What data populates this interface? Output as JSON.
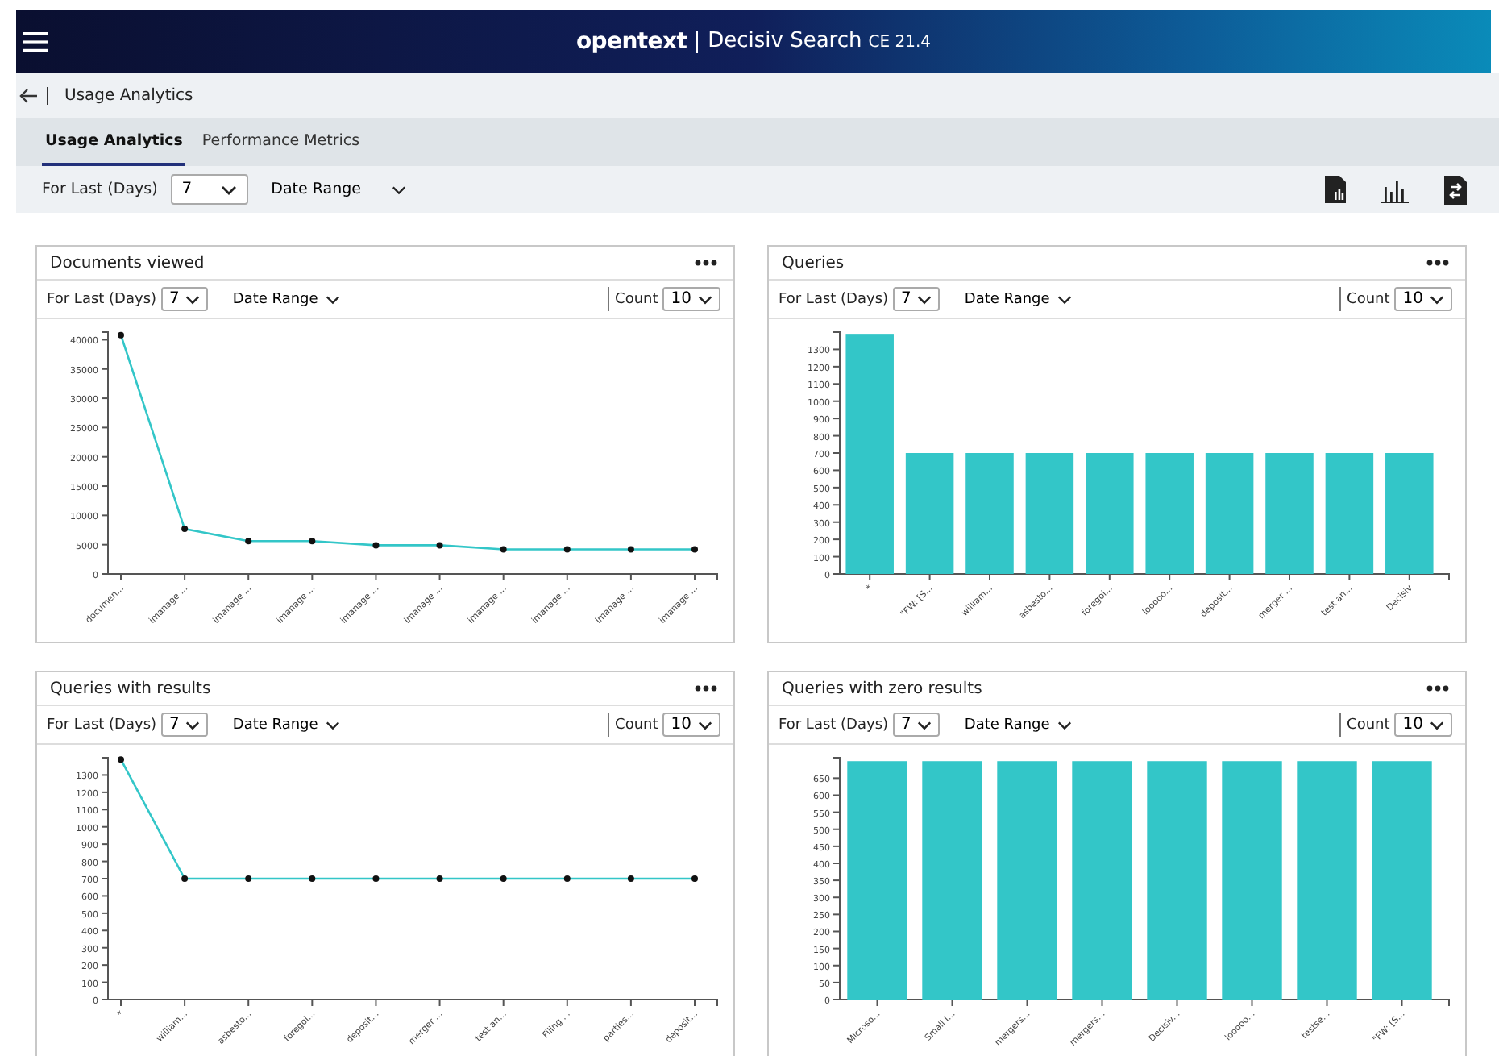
{
  "header": {
    "logo": "opentext",
    "product": "Decisiv Search",
    "version": "CE 21.4"
  },
  "breadcrumb": {
    "title": "Usage Analytics"
  },
  "tabs": [
    {
      "label": "Usage Analytics",
      "selected": true
    },
    {
      "label": "Performance Metrics",
      "selected": false
    }
  ],
  "filters": {
    "days_label": "For Last (Days)",
    "days_value": "7",
    "date_range": "Date Range"
  },
  "panels": [
    {
      "title": "Documents viewed",
      "days_label": "For Last (Days)",
      "days_value": "7",
      "date_range": "Date Range",
      "count_label": "Count",
      "count_value": "10",
      "chart_data": {
        "type": "line",
        "categories": [
          "documen...",
          "imanage ...",
          "imanage ...",
          "imanage ...",
          "imanage ...",
          "imanage ...",
          "imanage ...",
          "imanage ...",
          "imanage ...",
          "imanage ..."
        ],
        "series": [
          {
            "color": "#33c6c8",
            "marker": true,
            "values": [
              40800,
              7700,
              5600,
              5600,
              4900,
              4900,
              4200,
              4200,
              4200,
              4200
            ]
          }
        ],
        "ylim": [
          0,
          41300
        ],
        "yticks": [
          0,
          5000,
          10000,
          15000,
          20000,
          25000,
          30000,
          35000,
          40000
        ]
      }
    },
    {
      "title": "Queries",
      "days_label": "For Last (Days)",
      "days_value": "7",
      "date_range": "Date Range",
      "count_label": "Count",
      "count_value": "10",
      "chart_data": {
        "type": "bar",
        "categories": [
          "*",
          "\"FW: [S...",
          "william...",
          "asbesto...",
          "foregoi...",
          "looooo...",
          "deposit...",
          "merger ...",
          "test an...",
          "Decisiv"
        ],
        "series": [
          {
            "color": "#33c6c8",
            "values": [
              1390,
              700,
              700,
              700,
              700,
              700,
              700,
              700,
              700,
              700
            ]
          }
        ],
        "ylim": [
          0,
          1400
        ],
        "yticks": [
          0,
          100,
          200,
          300,
          400,
          500,
          600,
          700,
          800,
          900,
          1000,
          1100,
          1200,
          1300
        ]
      }
    },
    {
      "title": "Queries with results",
      "days_label": "For Last (Days)",
      "days_value": "7",
      "date_range": "Date Range",
      "count_label": "Count",
      "count_value": "10",
      "chart_data": {
        "type": "line",
        "categories": [
          "*",
          "william...",
          "asbesto...",
          "foregoi...",
          "deposit...",
          "merger ...",
          "test an...",
          "Filing ...",
          "parties...",
          "deposit..."
        ],
        "series": [
          {
            "color": "#33c6c8",
            "marker": true,
            "values": [
              1390,
              700,
              700,
              700,
              700,
              700,
              700,
              700,
              700,
              700
            ]
          }
        ],
        "ylim": [
          0,
          1400
        ],
        "yticks": [
          0,
          100,
          200,
          300,
          400,
          500,
          600,
          700,
          800,
          900,
          1000,
          1100,
          1200,
          1300
        ]
      }
    },
    {
      "title": "Queries with zero results",
      "days_label": "For Last (Days)",
      "days_value": "7",
      "date_range": "Date Range",
      "count_label": "Count",
      "count_value": "10",
      "chart_data": {
        "type": "bar",
        "categories": [
          "Microso...",
          "Small I...",
          "mergers...",
          "mergers...",
          "Decisiv...",
          "looooo...",
          "testse...",
          "\"FW: [S..."
        ],
        "series": [
          {
            "color": "#33c6c8",
            "values": [
              700,
              700,
              700,
              700,
              700,
              700,
              700,
              700
            ]
          }
        ],
        "ylim": [
          0,
          710
        ],
        "yticks": [
          0,
          50,
          100,
          150,
          200,
          250,
          300,
          350,
          400,
          450,
          500,
          550,
          600,
          650
        ]
      }
    }
  ]
}
